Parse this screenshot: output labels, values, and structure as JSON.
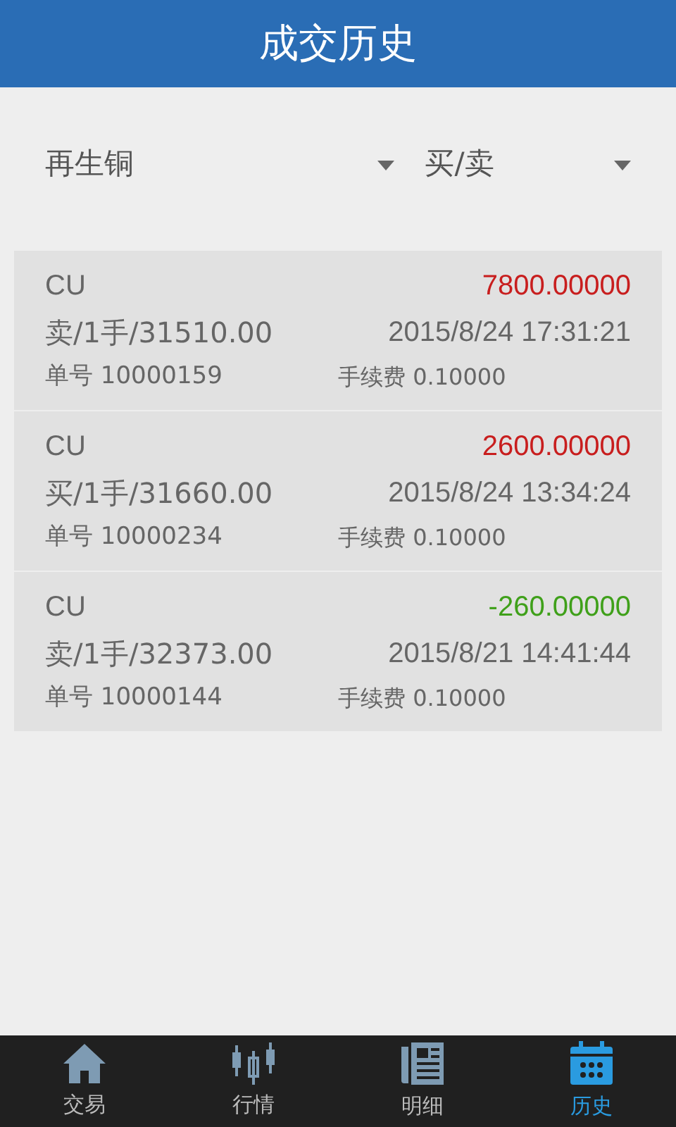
{
  "header": {
    "title": "成交历史"
  },
  "filters": [
    {
      "value": "再生铜"
    },
    {
      "value": "买/卖"
    }
  ],
  "trades": [
    {
      "symbol": "CU",
      "amount": "7800.00000",
      "color": "#c81e1e",
      "detail": "卖/1手/31510.00",
      "time": "2015/8/24 17:31:21",
      "order_no": "单号 10000159",
      "fee": "手续费 0.10000"
    },
    {
      "symbol": "CU",
      "amount": "2600.00000",
      "color": "#c81e1e",
      "detail": "买/1手/31660.00",
      "time": "2015/8/24 13:34:24",
      "order_no": "单号 10000234",
      "fee": "手续费 0.10000"
    },
    {
      "symbol": "CU",
      "amount": "-260.00000",
      "color": "#3fa01a",
      "detail": "卖/1手/32373.00",
      "time": "2015/8/21 14:41:44",
      "order_no": "单号 10000144",
      "fee": "手续费 0.10000"
    }
  ],
  "tabs": [
    {
      "kind": "home",
      "label": "交易",
      "selected": false
    },
    {
      "kind": "candles",
      "label": "行情",
      "selected": false
    },
    {
      "kind": "news",
      "label": "明细",
      "selected": false
    },
    {
      "kind": "calendar",
      "label": "历史",
      "selected": true
    }
  ]
}
